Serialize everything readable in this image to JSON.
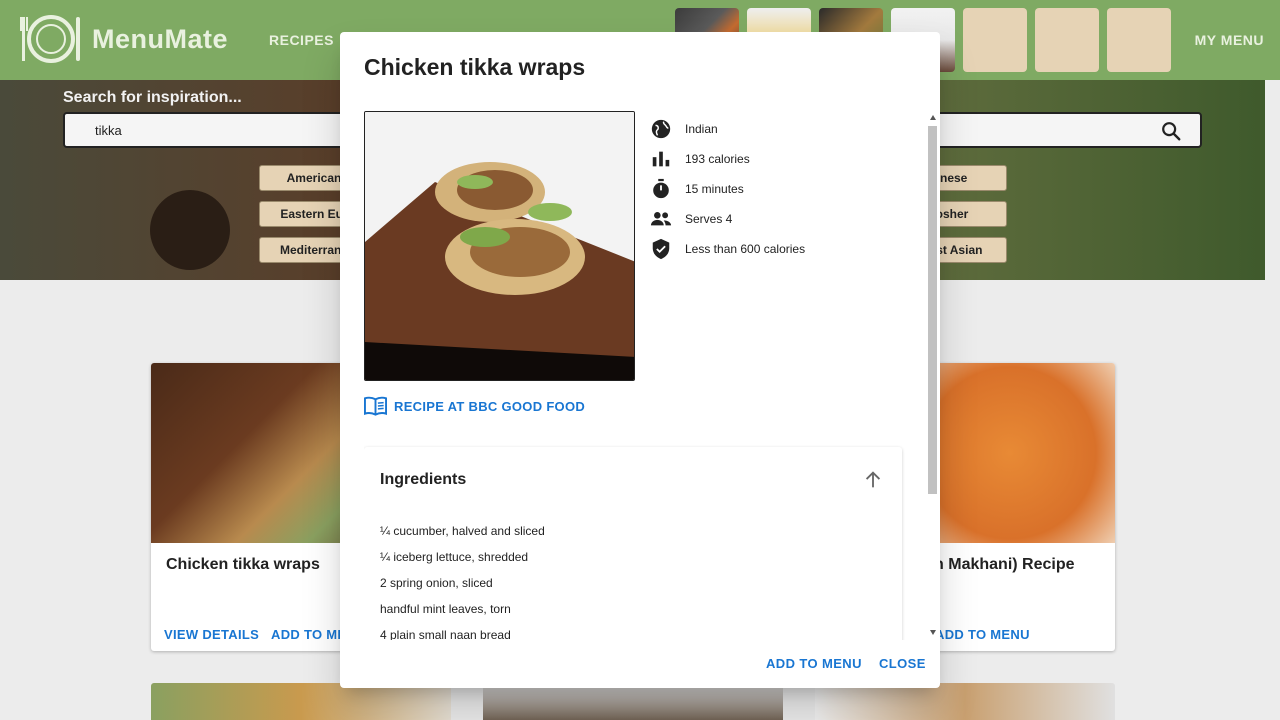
{
  "header": {
    "brand": "MenuMate",
    "nav_recipes": "RECIPES",
    "nav_my_menu": "MY MENU",
    "accent": "#7faa63"
  },
  "search": {
    "label": "Search for inspiration...",
    "value": "tikka"
  },
  "cuisine_chips": [
    {
      "label": "American"
    },
    {
      "label": "Eastern Eur"
    },
    {
      "label": "Mediterrane"
    },
    {
      "label": "inese"
    },
    {
      "label": "osher"
    },
    {
      "label": "East Asian"
    }
  ],
  "cards": [
    {
      "title": "Chicken tikka wraps",
      "view": "VIEW DETAILS",
      "add": "ADD TO ME"
    },
    {
      "title": "Butter Chicken Makhani) Recipe",
      "add": "ADD TO MENU"
    }
  ],
  "dialog": {
    "title": "Chicken tikka wraps",
    "info": [
      {
        "icon": "globe-icon",
        "text": "Indian"
      },
      {
        "icon": "bar-chart-icon",
        "text": "193 calories"
      },
      {
        "icon": "timer-icon",
        "text": "15 minutes"
      },
      {
        "icon": "people-icon",
        "text": "Serves 4"
      },
      {
        "icon": "shield-check-icon",
        "text": "Less than 600 calories"
      }
    ],
    "source_link": "RECIPE AT BBC GOOD FOOD",
    "ingredients_title": "Ingredients",
    "ingredients": [
      "¼ cucumber, halved and sliced",
      "¼ iceberg lettuce, shredded",
      "2 spring onion, sliced",
      "handful mint leaves, torn",
      "4 plain small naan bread"
    ],
    "add_button": "ADD TO MENU",
    "close_button": "CLOSE",
    "link_color": "#1976d2"
  }
}
